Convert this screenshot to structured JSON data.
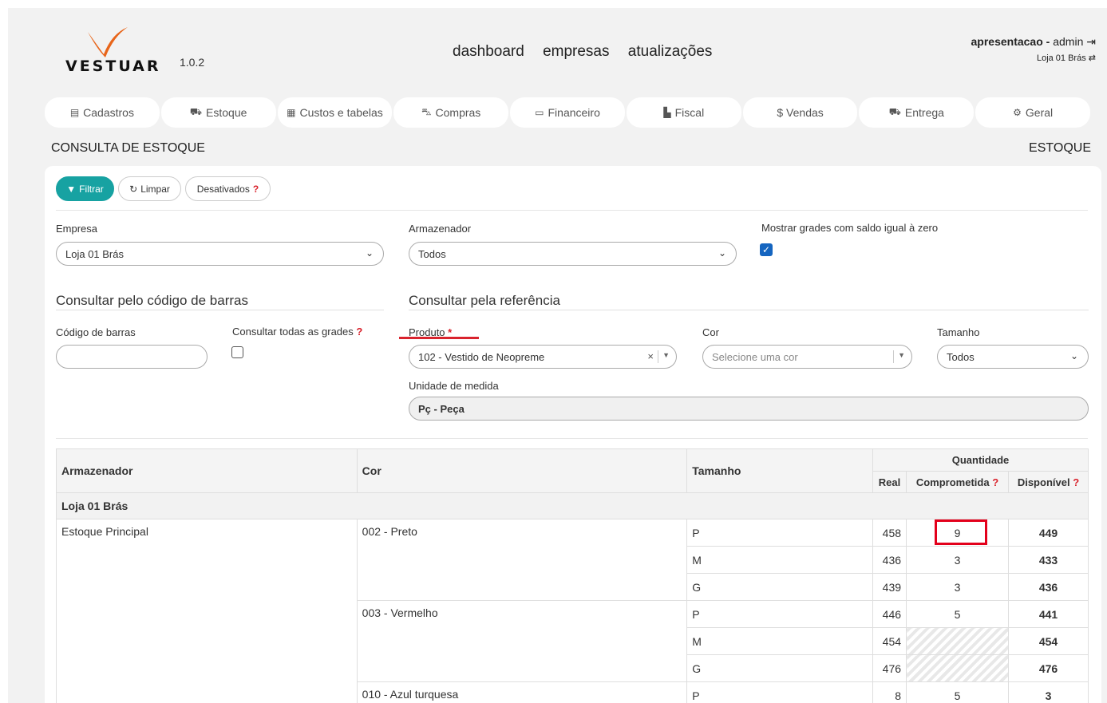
{
  "header": {
    "brand": "VESTUAR",
    "version": "1.0.2",
    "nav": [
      "dashboard",
      "empresas",
      "atualizações"
    ],
    "user_company": "apresentacao",
    "user_sep": " - ",
    "user_name": "admin",
    "store": "Loja 01 Brás"
  },
  "module_tabs": [
    {
      "label": "Cadastros",
      "icon": "file-icon"
    },
    {
      "label": "Estoque",
      "icon": "truck-icon"
    },
    {
      "label": "Custos e tabelas",
      "icon": "table-icon"
    },
    {
      "label": "Compras",
      "icon": "cart-icon"
    },
    {
      "label": "Financeiro",
      "icon": "card-icon"
    },
    {
      "label": "Fiscal",
      "icon": "document-icon"
    },
    {
      "label": "$ Vendas",
      "icon": ""
    },
    {
      "label": "Entrega",
      "icon": "truck-icon"
    },
    {
      "label": "Geral",
      "icon": "gears-icon"
    }
  ],
  "page": {
    "title": "CONSULTA DE ESTOQUE",
    "section": "ESTOQUE"
  },
  "toolbar": {
    "filter": "Filtrar",
    "clear": "Limpar",
    "disabled": "Desativados",
    "help": "?"
  },
  "filters": {
    "empresa_label": "Empresa",
    "empresa_value": "Loja 01 Brás",
    "armazenador_label": "Armazenador",
    "armazenador_value": "Todos",
    "zero_label": "Mostrar grades com saldo igual à zero",
    "zero_checked": true,
    "barcode_section": "Consultar pelo código de barras",
    "barcode_label": "Código de barras",
    "barcode_value": "",
    "all_grades_label": "Consultar todas as grades",
    "all_grades_checked": false,
    "ref_section": "Consultar pela referência",
    "produto_label": "Produto",
    "produto_required": "*",
    "produto_value": "102 - Vestido de Neopreme",
    "cor_label": "Cor",
    "cor_placeholder": "Selecione uma cor",
    "tamanho_label": "Tamanho",
    "tamanho_value": "Todos",
    "unidade_label": "Unidade de medida",
    "unidade_value": "Pç - Peça"
  },
  "table": {
    "headers": {
      "armazenador": "Armazenador",
      "cor": "Cor",
      "tamanho": "Tamanho",
      "quantidade": "Quantidade",
      "real": "Real",
      "comprometida": "Comprometida",
      "disponivel": "Disponível"
    },
    "group": "Loja 01 Brás",
    "warehouse": "Estoque Principal",
    "rows": [
      {
        "cor": "002 - Preto",
        "tamanho": "P",
        "real": "458",
        "comp": "9",
        "disp": "449"
      },
      {
        "cor": "",
        "tamanho": "M",
        "real": "436",
        "comp": "3",
        "disp": "433"
      },
      {
        "cor": "",
        "tamanho": "G",
        "real": "439",
        "comp": "3",
        "disp": "436"
      },
      {
        "cor": "003 - Vermelho",
        "tamanho": "P",
        "real": "446",
        "comp": "5",
        "disp": "441"
      },
      {
        "cor": "",
        "tamanho": "M",
        "real": "454",
        "comp": "",
        "disp": "454"
      },
      {
        "cor": "",
        "tamanho": "G",
        "real": "476",
        "comp": "",
        "disp": "476"
      },
      {
        "cor": "010 - Azul turquesa",
        "tamanho": "P",
        "real": "8",
        "comp": "5",
        "disp": "3"
      }
    ]
  },
  "colors": {
    "accent": "#17a2a2",
    "logo": "#e8651a",
    "highlight": "#e3001b",
    "available": "#2e7d17",
    "link": "#337ab7"
  }
}
